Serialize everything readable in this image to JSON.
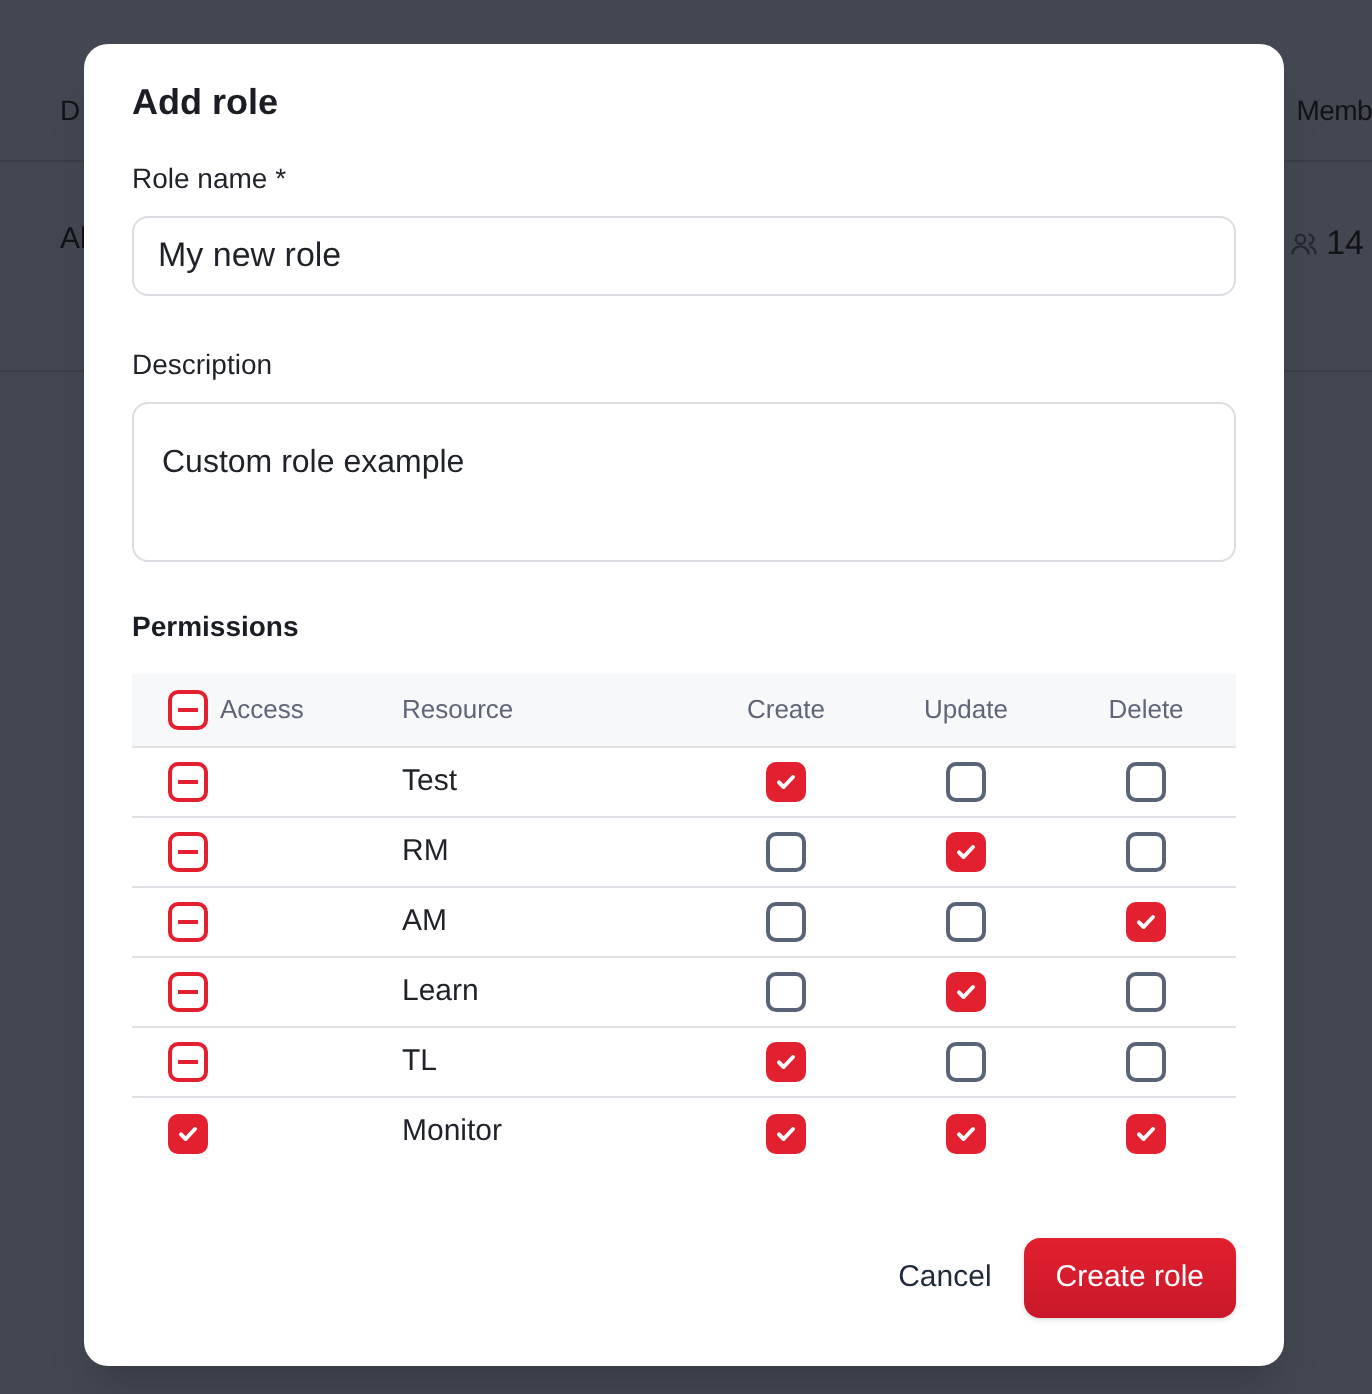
{
  "background_table": {
    "columns": [
      "D",
      "Memb"
    ],
    "rows": [
      {
        "cells": [
          "Al",
          "14"
        ]
      }
    ]
  },
  "dialog": {
    "title": "Add role",
    "fields": [
      {
        "kind": "input",
        "label": "Role name *",
        "value": "My new role"
      },
      {
        "kind": "textarea",
        "label": "Description",
        "value": "Custom role example"
      }
    ],
    "permissions": {
      "title": "Permissions",
      "header_access": {
        "checked": true,
        "indeterminate": true
      },
      "columns": [
        "Access",
        "Resource",
        "Create",
        "Update",
        "Delete"
      ],
      "rows": [
        {
          "access": {
            "checked": true,
            "indeterminate": true
          },
          "resource": "Test",
          "create": true,
          "update": false,
          "delete": false
        },
        {
          "access": {
            "checked": true,
            "indeterminate": true
          },
          "resource": "RM",
          "create": false,
          "update": true,
          "delete": false
        },
        {
          "access": {
            "checked": true,
            "indeterminate": true
          },
          "resource": "AM",
          "create": false,
          "update": false,
          "delete": true
        },
        {
          "access": {
            "checked": true,
            "indeterminate": true
          },
          "resource": "Learn",
          "create": false,
          "update": true,
          "delete": false
        },
        {
          "access": {
            "checked": true,
            "indeterminate": true
          },
          "resource": "TL",
          "create": true,
          "update": false,
          "delete": false
        },
        {
          "access": {
            "checked": true,
            "indeterminate": false
          },
          "resource": "Monitor",
          "create": true,
          "update": true,
          "delete": true
        }
      ]
    },
    "buttons": [
      {
        "kind": "secondary",
        "label": "Cancel"
      },
      {
        "kind": "primary",
        "label": "Create role"
      }
    ]
  }
}
